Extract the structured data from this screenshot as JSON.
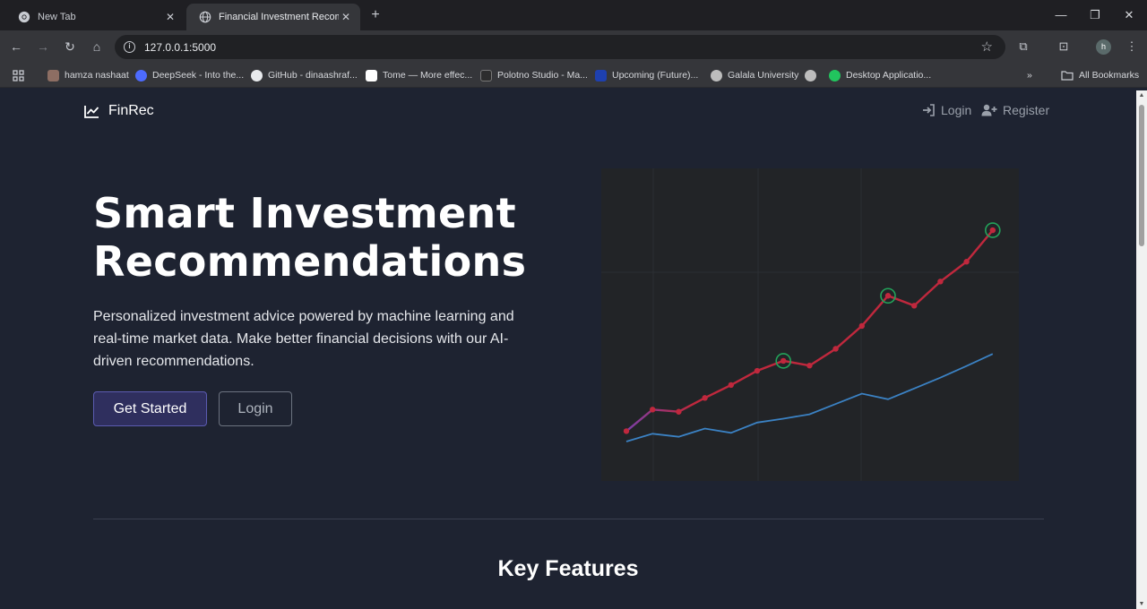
{
  "browser": {
    "tabs": [
      {
        "title": "New Tab",
        "active": false
      },
      {
        "title": "Financial Investment Recommen",
        "active": true
      }
    ],
    "url": "127.0.0.1:5000",
    "profile_initial": "h",
    "bookmarks": [
      {
        "label": "hamza nashaat",
        "icon": "image-icon",
        "color": "#8d6e63"
      },
      {
        "label": "DeepSeek - Into the...",
        "icon": "deepseek-icon",
        "color": "#4d6bfe"
      },
      {
        "label": "GitHub - dinaashraf...",
        "icon": "github-icon",
        "color": "#e8eaed"
      },
      {
        "label": "Tome — More effec...",
        "icon": "tome-icon",
        "color": "#ffffff"
      },
      {
        "label": "Polotno Studio - Ma...",
        "icon": "polotno-icon",
        "color": "#2d2d2d"
      },
      {
        "label": "Upcoming (Future)...",
        "icon": "as-icon",
        "color": "#1e40af"
      },
      {
        "label": "Galala University",
        "icon": "globe-icon",
        "color": "#bdbdbd"
      },
      {
        "label": "",
        "icon": "globe-icon",
        "color": "#bdbdbd"
      },
      {
        "label": "Desktop Applicatio...",
        "icon": "app-icon",
        "color": "#22c55e"
      }
    ],
    "all_bookmarks": "All Bookmarks"
  },
  "nav": {
    "brand": "FinRec",
    "login": "Login",
    "register": "Register"
  },
  "hero": {
    "title": "Smart Investment Recommendations",
    "description": "Personalized investment advice powered by machine learning and real-time market data. Make better financial decisions with our AI-driven recommendations.",
    "primary_button": "Get Started",
    "secondary_button": "Login"
  },
  "features": {
    "title": "Key Features"
  },
  "colors": {
    "background": "#1e2331",
    "chart_bg": "#222427",
    "portfolio_line": "#c0283d",
    "portfolio_line_start": "#7b3fa8",
    "market_line": "#3b82c4",
    "marker_ring": "#22a35a"
  },
  "chart_data": {
    "type": "line",
    "x": [
      1,
      2,
      3,
      4,
      5,
      6,
      7,
      8,
      9,
      10,
      11,
      12,
      13,
      14
    ],
    "series": [
      {
        "values": [
          10.3,
          15.3,
          14.8,
          18.0,
          21.0,
          24.3,
          26.6,
          25.5,
          29.4,
          34.7,
          41.7,
          39.4,
          45.0,
          49.6,
          56.9
        ]
      },
      {
        "values": [
          7.9,
          9.7,
          9.0,
          10.9,
          9.9,
          12.3,
          13.2,
          14.2,
          16.6,
          19.0,
          17.7,
          20.2,
          22.7,
          25.4,
          28.2
        ]
      }
    ],
    "highlights": [
      6,
      10,
      14
    ],
    "ylim": [
      0,
      70
    ],
    "grid": true
  }
}
